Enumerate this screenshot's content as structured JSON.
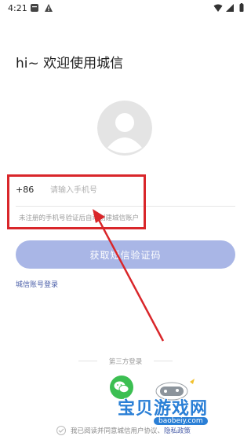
{
  "status_bar": {
    "time": "4:21"
  },
  "greeting": "hi~ 欢迎使用城信",
  "phone": {
    "country_code": "+86",
    "placeholder": "请输入手机号",
    "value": ""
  },
  "hint": "未注册的手机号验证后自动创建城信账户",
  "sms_button": "获取短信验证码",
  "account_login_link": "城信账号登录",
  "third_party": {
    "label": "第三方登录"
  },
  "agreement": {
    "prefix": "我已阅读并同意城信用户协议、",
    "policy": "隐私政策"
  },
  "colors": {
    "accent": "#a9b6e6",
    "link": "#4a5ea8",
    "annotation": "#d9262a",
    "wechat": "#3cbf52"
  },
  "watermark": {
    "text": "宝贝游戏网",
    "url": "baobeiy.com"
  }
}
